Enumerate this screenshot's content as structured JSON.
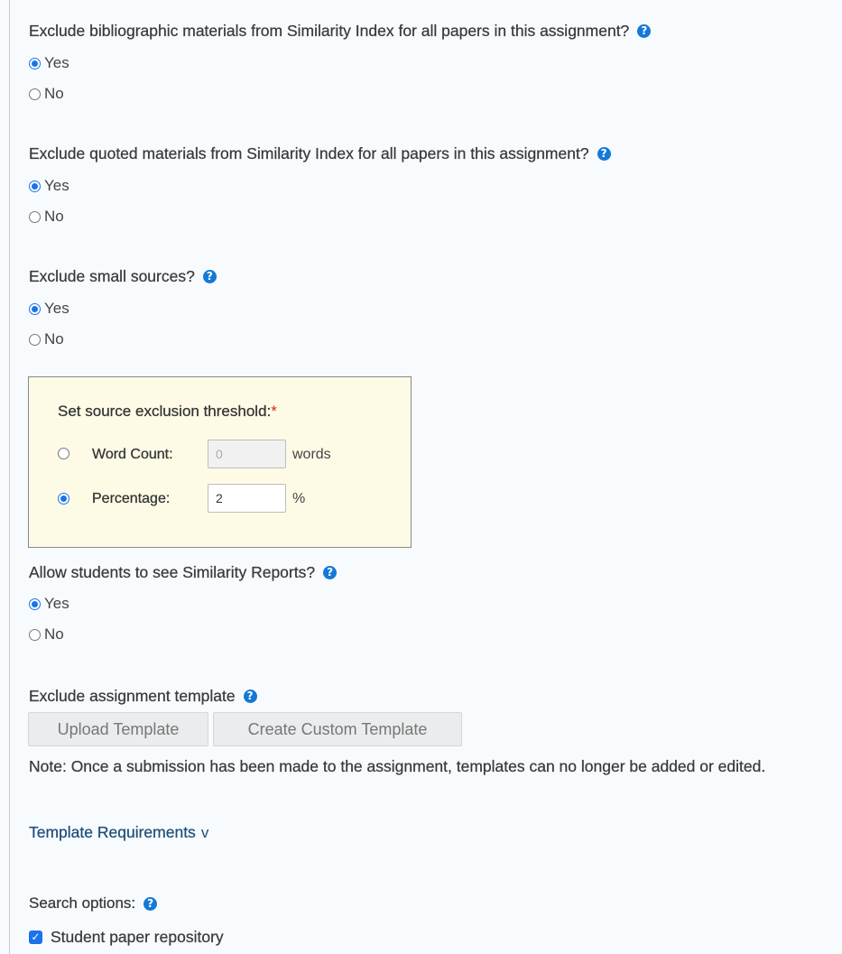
{
  "questions": [
    {
      "label": "Exclude bibliographic materials from Similarity Index for all papers in this assignment?",
      "options": [
        {
          "label": "Yes",
          "selected": true
        },
        {
          "label": "No",
          "selected": false
        }
      ]
    },
    {
      "label": "Exclude quoted materials from Similarity Index for all papers in this assignment?",
      "options": [
        {
          "label": "Yes",
          "selected": true
        },
        {
          "label": "No",
          "selected": false
        }
      ]
    },
    {
      "label": "Exclude small sources?",
      "options": [
        {
          "label": "Yes",
          "selected": true
        },
        {
          "label": "No",
          "selected": false
        }
      ]
    },
    {
      "label": "Allow students to see Similarity Reports?",
      "options": [
        {
          "label": "Yes",
          "selected": true
        },
        {
          "label": "No",
          "selected": false
        }
      ]
    }
  ],
  "help_icon": "?",
  "threshold": {
    "title": "Set source exclusion threshold:",
    "required_marker": "*",
    "word_count": {
      "label": "Word Count:",
      "value": "0",
      "unit": "words",
      "selected": false,
      "disabled": true
    },
    "percentage": {
      "label": "Percentage:",
      "value": "2",
      "unit": "%",
      "selected": true
    }
  },
  "template": {
    "label": "Exclude assignment template",
    "upload_button": "Upload Template",
    "custom_button": "Create Custom Template",
    "note": "Note: Once a submission has been made to the assignment, templates can no longer be added or edited.",
    "requirements_link": "Template Requirements",
    "requirements_chevron": "v"
  },
  "search_options": {
    "label": "Search options:",
    "items": [
      {
        "label": "Student paper repository",
        "checked": true
      }
    ]
  },
  "colors": {
    "accent": "#1a73e8",
    "help": "#1479d6",
    "link": "#1d4e7a",
    "box_bg": "#fdfbe6"
  }
}
